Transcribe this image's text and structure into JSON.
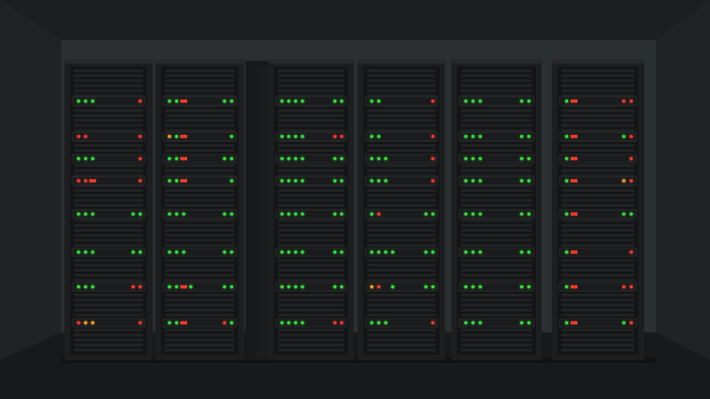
{
  "scene": {
    "subject": "server-room",
    "colors": {
      "ceiling": "#1b1f21",
      "back_wall": "#2a2f31",
      "side_wall": "#1f2325",
      "floor": "#161a1c",
      "rack_body": "#1c1e1f",
      "rack_edge": "#262829",
      "rack_inner": "#141516",
      "unit": "#202223",
      "unit_line": "#2c2e2f",
      "led_green": "#34e03c",
      "led_red": "#f03a2e",
      "led_amber": "#e8a030"
    },
    "racks": [
      {
        "rows": [
          [
            "g",
            "g",
            "g",
            "",
            "",
            "r"
          ],
          [
            "r",
            "r",
            "",
            "",
            "",
            "r"
          ],
          [
            "g",
            "g",
            "g",
            "",
            "",
            "r"
          ],
          [
            "r",
            "r",
            "r",
            "",
            "",
            "r"
          ],
          [
            "g",
            "g",
            "g",
            "",
            "g",
            "g"
          ],
          [
            "g",
            "g",
            "g",
            "",
            "g",
            "g"
          ],
          [
            "g",
            "g",
            "g",
            "",
            "r",
            "r"
          ],
          [
            "r",
            "a",
            "a",
            "",
            "",
            "r"
          ]
        ]
      },
      {
        "rows": [
          [
            "g",
            "g",
            "r",
            "",
            "g",
            "g"
          ],
          [
            "a",
            "g",
            "r",
            "",
            "",
            "g"
          ],
          [
            "g",
            "g",
            "r",
            "",
            "g",
            "g"
          ],
          [
            "g",
            "g",
            "r",
            "",
            "",
            "g"
          ],
          [
            "g",
            "g",
            "g",
            "",
            "g",
            "g"
          ],
          [
            "g",
            "g",
            "g",
            "",
            "g",
            "g"
          ],
          [
            "g",
            "g",
            "r",
            "g",
            "g",
            "g"
          ],
          [
            "g",
            "g",
            "r",
            "",
            "r",
            "g"
          ]
        ]
      },
      {
        "rows": [
          [
            "g",
            "g",
            "g",
            "g",
            "g",
            "g"
          ],
          [
            "g",
            "g",
            "g",
            "g",
            "r",
            "r"
          ],
          [
            "g",
            "g",
            "g",
            "g",
            "g",
            "g"
          ],
          [
            "g",
            "g",
            "g",
            "g",
            "g",
            "g"
          ],
          [
            "g",
            "g",
            "g",
            "g",
            "g",
            "g"
          ],
          [
            "g",
            "g",
            "g",
            "g",
            "g",
            "g"
          ],
          [
            "g",
            "g",
            "g",
            "g",
            "g",
            "g"
          ],
          [
            "g",
            "g",
            "g",
            "g",
            "r",
            "r"
          ]
        ]
      },
      {
        "rows": [
          [
            "g",
            "g",
            "",
            "",
            "",
            "r"
          ],
          [
            "g",
            "g",
            "",
            "",
            "",
            "r"
          ],
          [
            "g",
            "g",
            "g",
            "",
            "",
            "r"
          ],
          [
            "g",
            "g",
            "g",
            "",
            "",
            "r"
          ],
          [
            "g",
            "r",
            "",
            "",
            "g",
            "g"
          ],
          [
            "g",
            "g",
            "g",
            "g",
            "g",
            "g"
          ],
          [
            "a",
            "r",
            "",
            "g",
            "g",
            "g"
          ],
          [
            "g",
            "g",
            "g",
            "",
            "",
            "r"
          ]
        ]
      },
      {
        "rows": [
          [
            "g",
            "g",
            "g",
            "",
            "g",
            "g"
          ],
          [
            "g",
            "g",
            "g",
            "",
            "g",
            "g"
          ],
          [
            "g",
            "g",
            "g",
            "",
            "g",
            "g"
          ],
          [
            "g",
            "g",
            "g",
            "",
            "g",
            "g"
          ],
          [
            "g",
            "g",
            "g",
            "",
            "g",
            "g"
          ],
          [
            "g",
            "g",
            "g",
            "",
            "g",
            "g"
          ],
          [
            "g",
            "g",
            "g",
            "",
            "g",
            "g"
          ],
          [
            "g",
            "g",
            "g",
            "",
            "g",
            "g"
          ]
        ]
      },
      {
        "rows": [
          [
            "g",
            "r",
            "",
            "",
            "r",
            "r"
          ],
          [
            "g",
            "r",
            "",
            "",
            "g",
            "r"
          ],
          [
            "g",
            "r",
            "",
            "",
            "",
            "r"
          ],
          [
            "g",
            "r",
            "",
            "",
            "a",
            "r"
          ],
          [
            "g",
            "r",
            "",
            "",
            "g",
            "g"
          ],
          [
            "g",
            "r",
            "",
            "",
            "",
            "r"
          ],
          [
            "g",
            "r",
            "",
            "",
            "r",
            "r"
          ],
          [
            "g",
            "r",
            "",
            "",
            "g",
            "r"
          ]
        ]
      }
    ]
  }
}
